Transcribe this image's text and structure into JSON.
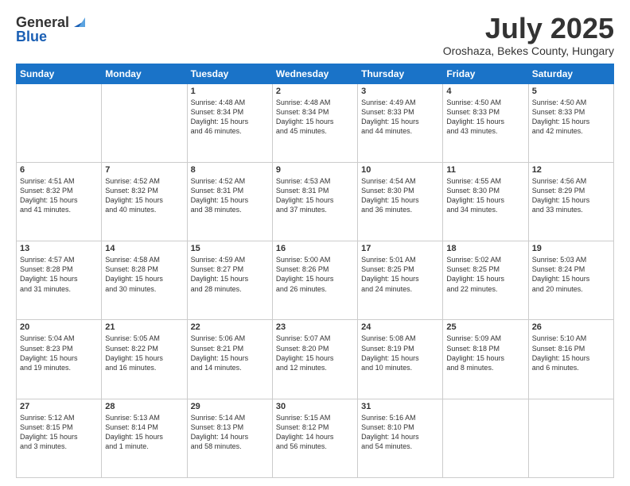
{
  "logo": {
    "line1": "General",
    "line2": "Blue"
  },
  "header": {
    "month": "July 2025",
    "location": "Oroshaza, Bekes County, Hungary"
  },
  "weekdays": [
    "Sunday",
    "Monday",
    "Tuesday",
    "Wednesday",
    "Thursday",
    "Friday",
    "Saturday"
  ],
  "weeks": [
    [
      {
        "day": "",
        "info": ""
      },
      {
        "day": "",
        "info": ""
      },
      {
        "day": "1",
        "info": "Sunrise: 4:48 AM\nSunset: 8:34 PM\nDaylight: 15 hours\nand 46 minutes."
      },
      {
        "day": "2",
        "info": "Sunrise: 4:48 AM\nSunset: 8:34 PM\nDaylight: 15 hours\nand 45 minutes."
      },
      {
        "day": "3",
        "info": "Sunrise: 4:49 AM\nSunset: 8:33 PM\nDaylight: 15 hours\nand 44 minutes."
      },
      {
        "day": "4",
        "info": "Sunrise: 4:50 AM\nSunset: 8:33 PM\nDaylight: 15 hours\nand 43 minutes."
      },
      {
        "day": "5",
        "info": "Sunrise: 4:50 AM\nSunset: 8:33 PM\nDaylight: 15 hours\nand 42 minutes."
      }
    ],
    [
      {
        "day": "6",
        "info": "Sunrise: 4:51 AM\nSunset: 8:32 PM\nDaylight: 15 hours\nand 41 minutes."
      },
      {
        "day": "7",
        "info": "Sunrise: 4:52 AM\nSunset: 8:32 PM\nDaylight: 15 hours\nand 40 minutes."
      },
      {
        "day": "8",
        "info": "Sunrise: 4:52 AM\nSunset: 8:31 PM\nDaylight: 15 hours\nand 38 minutes."
      },
      {
        "day": "9",
        "info": "Sunrise: 4:53 AM\nSunset: 8:31 PM\nDaylight: 15 hours\nand 37 minutes."
      },
      {
        "day": "10",
        "info": "Sunrise: 4:54 AM\nSunset: 8:30 PM\nDaylight: 15 hours\nand 36 minutes."
      },
      {
        "day": "11",
        "info": "Sunrise: 4:55 AM\nSunset: 8:30 PM\nDaylight: 15 hours\nand 34 minutes."
      },
      {
        "day": "12",
        "info": "Sunrise: 4:56 AM\nSunset: 8:29 PM\nDaylight: 15 hours\nand 33 minutes."
      }
    ],
    [
      {
        "day": "13",
        "info": "Sunrise: 4:57 AM\nSunset: 8:28 PM\nDaylight: 15 hours\nand 31 minutes."
      },
      {
        "day": "14",
        "info": "Sunrise: 4:58 AM\nSunset: 8:28 PM\nDaylight: 15 hours\nand 30 minutes."
      },
      {
        "day": "15",
        "info": "Sunrise: 4:59 AM\nSunset: 8:27 PM\nDaylight: 15 hours\nand 28 minutes."
      },
      {
        "day": "16",
        "info": "Sunrise: 5:00 AM\nSunset: 8:26 PM\nDaylight: 15 hours\nand 26 minutes."
      },
      {
        "day": "17",
        "info": "Sunrise: 5:01 AM\nSunset: 8:25 PM\nDaylight: 15 hours\nand 24 minutes."
      },
      {
        "day": "18",
        "info": "Sunrise: 5:02 AM\nSunset: 8:25 PM\nDaylight: 15 hours\nand 22 minutes."
      },
      {
        "day": "19",
        "info": "Sunrise: 5:03 AM\nSunset: 8:24 PM\nDaylight: 15 hours\nand 20 minutes."
      }
    ],
    [
      {
        "day": "20",
        "info": "Sunrise: 5:04 AM\nSunset: 8:23 PM\nDaylight: 15 hours\nand 19 minutes."
      },
      {
        "day": "21",
        "info": "Sunrise: 5:05 AM\nSunset: 8:22 PM\nDaylight: 15 hours\nand 16 minutes."
      },
      {
        "day": "22",
        "info": "Sunrise: 5:06 AM\nSunset: 8:21 PM\nDaylight: 15 hours\nand 14 minutes."
      },
      {
        "day": "23",
        "info": "Sunrise: 5:07 AM\nSunset: 8:20 PM\nDaylight: 15 hours\nand 12 minutes."
      },
      {
        "day": "24",
        "info": "Sunrise: 5:08 AM\nSunset: 8:19 PM\nDaylight: 15 hours\nand 10 minutes."
      },
      {
        "day": "25",
        "info": "Sunrise: 5:09 AM\nSunset: 8:18 PM\nDaylight: 15 hours\nand 8 minutes."
      },
      {
        "day": "26",
        "info": "Sunrise: 5:10 AM\nSunset: 8:16 PM\nDaylight: 15 hours\nand 6 minutes."
      }
    ],
    [
      {
        "day": "27",
        "info": "Sunrise: 5:12 AM\nSunset: 8:15 PM\nDaylight: 15 hours\nand 3 minutes."
      },
      {
        "day": "28",
        "info": "Sunrise: 5:13 AM\nSunset: 8:14 PM\nDaylight: 15 hours\nand 1 minute."
      },
      {
        "day": "29",
        "info": "Sunrise: 5:14 AM\nSunset: 8:13 PM\nDaylight: 14 hours\nand 58 minutes."
      },
      {
        "day": "30",
        "info": "Sunrise: 5:15 AM\nSunset: 8:12 PM\nDaylight: 14 hours\nand 56 minutes."
      },
      {
        "day": "31",
        "info": "Sunrise: 5:16 AM\nSunset: 8:10 PM\nDaylight: 14 hours\nand 54 minutes."
      },
      {
        "day": "",
        "info": ""
      },
      {
        "day": "",
        "info": ""
      }
    ]
  ]
}
